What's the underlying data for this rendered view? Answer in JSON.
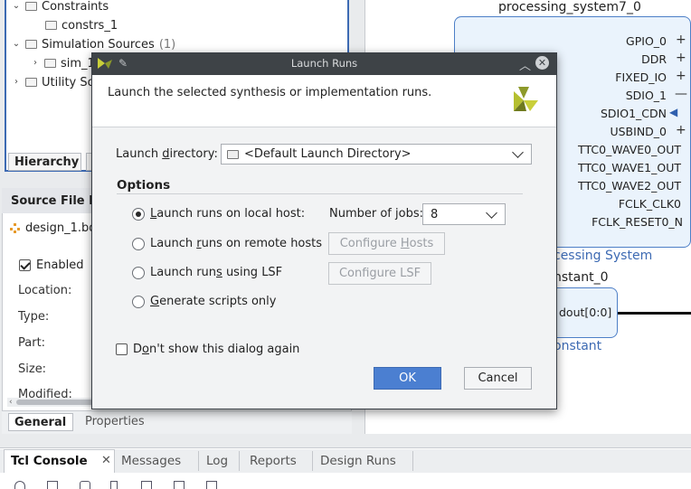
{
  "hierarchy": {
    "tree": [
      {
        "label": "Constraints",
        "count": ""
      },
      {
        "label": "constrs_1",
        "count": ""
      },
      {
        "label": "Simulation Sources",
        "count": "(1)"
      },
      {
        "label": "sim_1",
        "count": ""
      },
      {
        "label": "Utility So",
        "count": ""
      }
    ],
    "tab_label": "Hierarchy"
  },
  "source_file": {
    "title": "Source File P",
    "file": "design_1.bd",
    "enabled_label": "Enabled",
    "enabled_checked": true,
    "labels": [
      "Location:",
      "Type:",
      "Part:",
      "Size:",
      "Modified:"
    ],
    "tabs": [
      "General",
      "Properties"
    ]
  },
  "diagram": {
    "ps_title": "processing_system7_0",
    "ports": [
      {
        "name": "GPIO_0",
        "symbol": "+"
      },
      {
        "name": "DDR",
        "symbol": "+"
      },
      {
        "name": "FIXED_IO",
        "symbol": "+"
      },
      {
        "name": "SDIO_1",
        "symbol": "—"
      },
      {
        "name": "SDIO1_CDN",
        "symbol": "◀"
      },
      {
        "name": "USBIND_0",
        "symbol": "+"
      },
      {
        "name": "TTC0_WAVE0_OUT",
        "symbol": ""
      },
      {
        "name": "TTC0_WAVE1_OUT",
        "symbol": ""
      },
      {
        "name": "TTC0_WAVE2_OUT",
        "symbol": ""
      },
      {
        "name": "FCLK_CLK0",
        "symbol": ""
      },
      {
        "name": "FCLK_RESET0_N",
        "symbol": ""
      }
    ],
    "ps_caption": "cessing System",
    "const_title": "nstant_0",
    "const_port": "dout[0:0]",
    "const_caption": "onstant"
  },
  "console": {
    "tabs": [
      "Tcl Console",
      "Messages",
      "Log",
      "Reports",
      "Design Runs"
    ]
  },
  "dialog": {
    "title": "Launch Runs",
    "header": "Launch the selected synthesis or implementation runs.",
    "launch_dir_label_pre": "Launch ",
    "launch_dir_label_u": "d",
    "launch_dir_label_post": "irectory:",
    "launch_dir_value": "<Default Launch Directory>",
    "options_label": "Options",
    "opt_local_pre": "",
    "opt_local_u": "L",
    "opt_local_post": "aunch runs on local host:",
    "jobs_label": "Number of jobs:",
    "jobs_value": "8",
    "opt_remote_pre": "Launch ",
    "opt_remote_u": "r",
    "opt_remote_post": "uns on remote hosts",
    "configure_hosts_pre": "Configure ",
    "configure_hosts_u": "H",
    "configure_hosts_post": "osts",
    "opt_lsf_pre": "Launch run",
    "opt_lsf_u": "s",
    "opt_lsf_post": " using LSF",
    "configure_lsf": "Configure LSF",
    "opt_scripts_pre": "",
    "opt_scripts_u": "G",
    "opt_scripts_post": "enerate scripts only",
    "dont_show_pre": "D",
    "dont_show_u": "o",
    "dont_show_post": "n't show this dialog again",
    "ok": "OK",
    "cancel": "Cancel"
  }
}
